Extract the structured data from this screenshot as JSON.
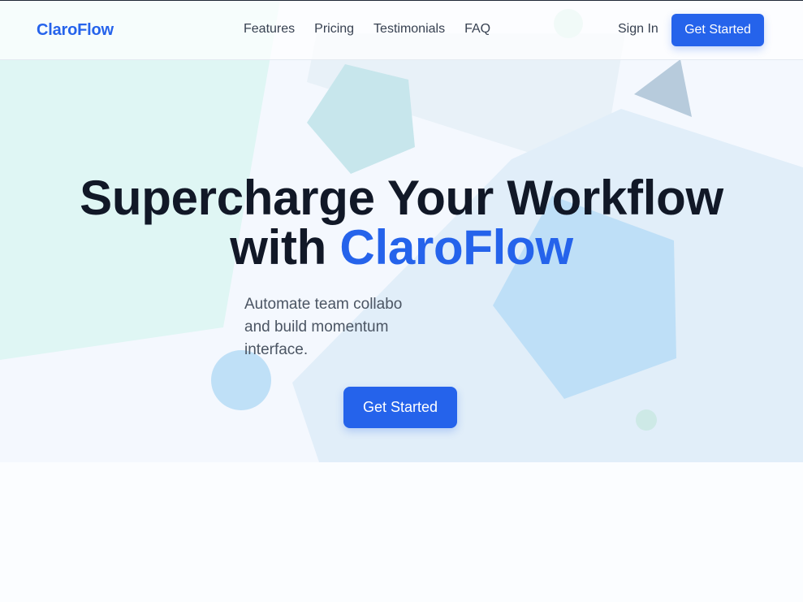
{
  "header": {
    "logo": "ClaroFlow",
    "nav": [
      {
        "label": "Features"
      },
      {
        "label": "Pricing"
      },
      {
        "label": "Testimonials"
      },
      {
        "label": "FAQ"
      }
    ],
    "sign_in": "Sign In",
    "cta": "Get Started"
  },
  "hero": {
    "headline_line1": "Supercharge Your Workflow",
    "headline_with": "with ",
    "headline_brand": "ClaroFlow",
    "subtitle_lines": [
      "Automate team collabo",
      "and build momentum",
      "interface."
    ],
    "cta": "Get Started"
  },
  "colors": {
    "brand": "#2563eb",
    "heading": "#111827",
    "body_text": "#4b5563"
  }
}
